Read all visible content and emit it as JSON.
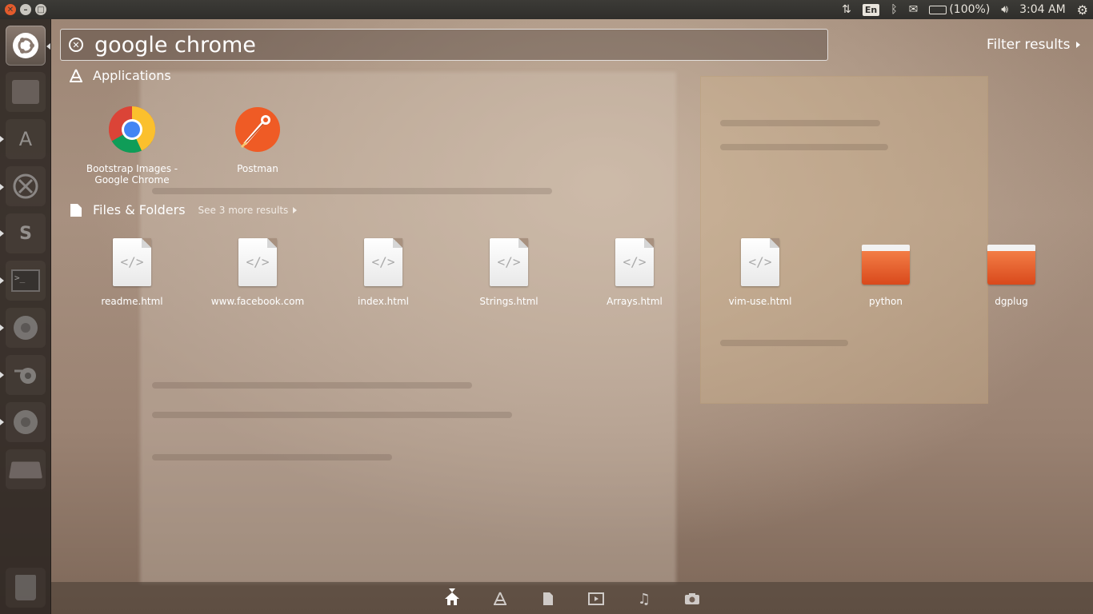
{
  "top_panel": {
    "keyboard_layout": "En",
    "battery_text": "(100%)",
    "clock": "3:04 AM"
  },
  "search": {
    "query": "google chrome",
    "filter_label": "Filter results"
  },
  "applications": {
    "header": "Applications",
    "items": [
      {
        "label": "Bootstrap Images - Google Chrome",
        "icon": "chrome-icon"
      },
      {
        "label": "Postman",
        "icon": "postman-icon"
      }
    ]
  },
  "files": {
    "header": "Files & Folders",
    "see_more": "See 3 more results",
    "items": [
      {
        "label": "readme.html",
        "type": "file"
      },
      {
        "label": "www.facebook.com",
        "type": "file"
      },
      {
        "label": "index.html",
        "type": "file"
      },
      {
        "label": "Strings.html",
        "type": "file"
      },
      {
        "label": "Arrays.html",
        "type": "file"
      },
      {
        "label": "vim-use.html",
        "type": "file"
      },
      {
        "label": "python",
        "type": "folder"
      },
      {
        "label": "dgplug",
        "type": "folder"
      }
    ]
  },
  "file_icon_glyph": "</>",
  "lenses": [
    "home-lens-icon",
    "applications-lens-icon",
    "files-lens-icon",
    "video-lens-icon",
    "music-lens-icon",
    "photos-lens-icon"
  ],
  "colors": {
    "accent_orange": "#dd4814",
    "panel_bg": "#3c3b37"
  }
}
